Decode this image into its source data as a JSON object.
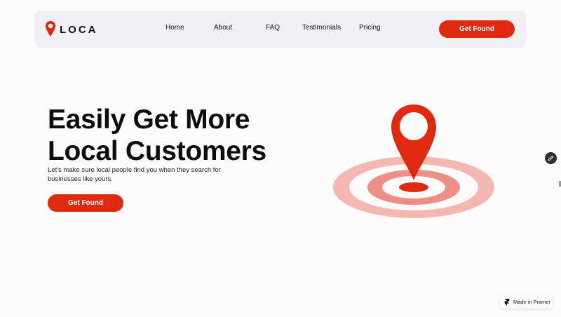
{
  "brand": {
    "name": "LOCA",
    "accent_color": "#e02a0f"
  },
  "nav": {
    "items": [
      {
        "label": "Home"
      },
      {
        "label": "About"
      },
      {
        "label": "FAQ"
      },
      {
        "label": "Testimonials"
      },
      {
        "label": "Pricing"
      }
    ],
    "cta_label": "Get Found"
  },
  "hero": {
    "title_line1": "Easily Get More",
    "title_line2": "Local Customers",
    "subtitle": "Let's make sure local people find you when they search for businesses like yours.",
    "cta_label": "Get Found"
  },
  "illustration": {
    "icon": "location-pin-target",
    "colors": {
      "pin": "#e02a0f",
      "ring_light": "#f5b8b0",
      "ring_mid": "#ee8f86"
    }
  },
  "badge": {
    "label": "Made in Framer"
  },
  "edit_button": {
    "icon": "pencil-icon"
  }
}
